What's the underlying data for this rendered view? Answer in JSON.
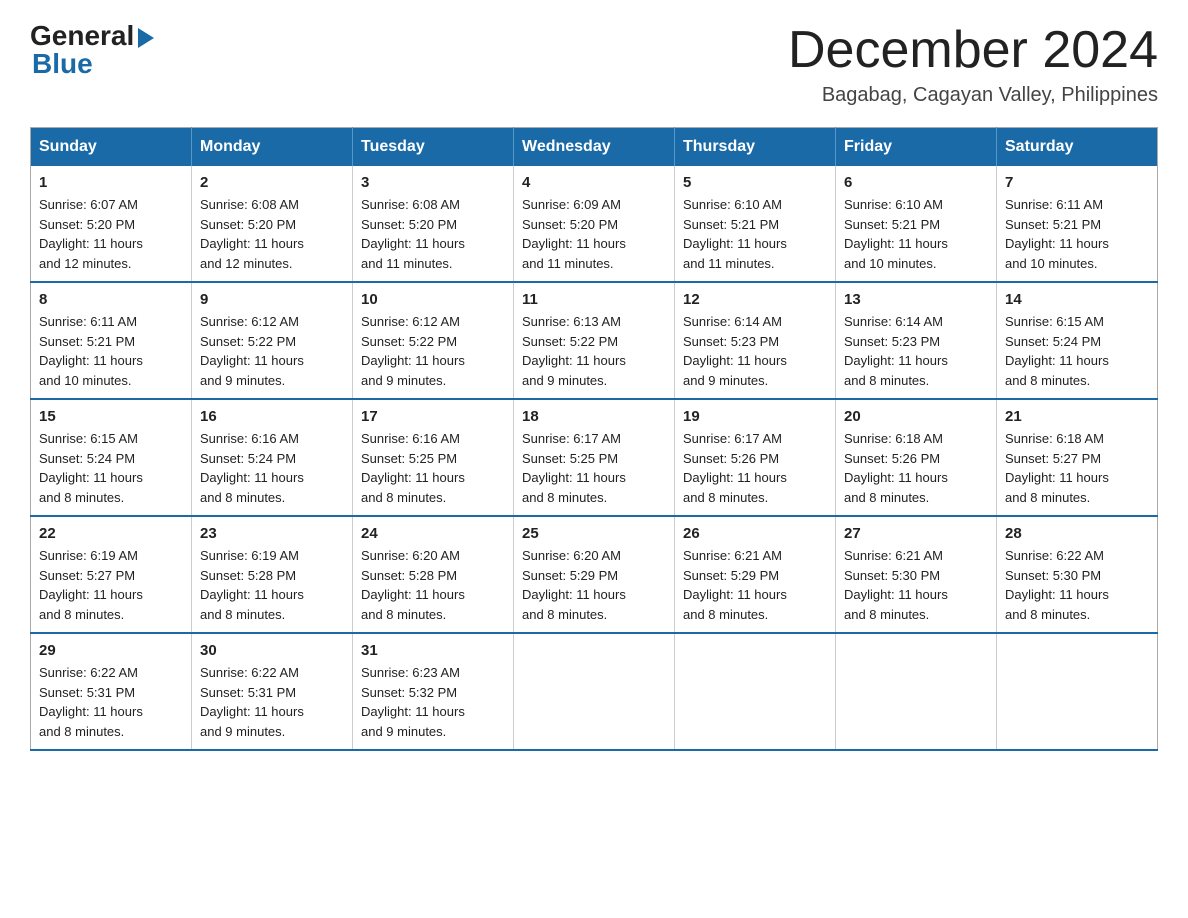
{
  "header": {
    "logo_general": "General",
    "logo_blue": "Blue",
    "month_year": "December 2024",
    "location": "Bagabag, Cagayan Valley, Philippines"
  },
  "calendar": {
    "days_of_week": [
      "Sunday",
      "Monday",
      "Tuesday",
      "Wednesday",
      "Thursday",
      "Friday",
      "Saturday"
    ],
    "weeks": [
      [
        {
          "day": "1",
          "sunrise": "6:07 AM",
          "sunset": "5:20 PM",
          "daylight": "11 hours and 12 minutes."
        },
        {
          "day": "2",
          "sunrise": "6:08 AM",
          "sunset": "5:20 PM",
          "daylight": "11 hours and 12 minutes."
        },
        {
          "day": "3",
          "sunrise": "6:08 AM",
          "sunset": "5:20 PM",
          "daylight": "11 hours and 11 minutes."
        },
        {
          "day": "4",
          "sunrise": "6:09 AM",
          "sunset": "5:20 PM",
          "daylight": "11 hours and 11 minutes."
        },
        {
          "day": "5",
          "sunrise": "6:10 AM",
          "sunset": "5:21 PM",
          "daylight": "11 hours and 11 minutes."
        },
        {
          "day": "6",
          "sunrise": "6:10 AM",
          "sunset": "5:21 PM",
          "daylight": "11 hours and 10 minutes."
        },
        {
          "day": "7",
          "sunrise": "6:11 AM",
          "sunset": "5:21 PM",
          "daylight": "11 hours and 10 minutes."
        }
      ],
      [
        {
          "day": "8",
          "sunrise": "6:11 AM",
          "sunset": "5:21 PM",
          "daylight": "11 hours and 10 minutes."
        },
        {
          "day": "9",
          "sunrise": "6:12 AM",
          "sunset": "5:22 PM",
          "daylight": "11 hours and 9 minutes."
        },
        {
          "day": "10",
          "sunrise": "6:12 AM",
          "sunset": "5:22 PM",
          "daylight": "11 hours and 9 minutes."
        },
        {
          "day": "11",
          "sunrise": "6:13 AM",
          "sunset": "5:22 PM",
          "daylight": "11 hours and 9 minutes."
        },
        {
          "day": "12",
          "sunrise": "6:14 AM",
          "sunset": "5:23 PM",
          "daylight": "11 hours and 9 minutes."
        },
        {
          "day": "13",
          "sunrise": "6:14 AM",
          "sunset": "5:23 PM",
          "daylight": "11 hours and 8 minutes."
        },
        {
          "day": "14",
          "sunrise": "6:15 AM",
          "sunset": "5:24 PM",
          "daylight": "11 hours and 8 minutes."
        }
      ],
      [
        {
          "day": "15",
          "sunrise": "6:15 AM",
          "sunset": "5:24 PM",
          "daylight": "11 hours and 8 minutes."
        },
        {
          "day": "16",
          "sunrise": "6:16 AM",
          "sunset": "5:24 PM",
          "daylight": "11 hours and 8 minutes."
        },
        {
          "day": "17",
          "sunrise": "6:16 AM",
          "sunset": "5:25 PM",
          "daylight": "11 hours and 8 minutes."
        },
        {
          "day": "18",
          "sunrise": "6:17 AM",
          "sunset": "5:25 PM",
          "daylight": "11 hours and 8 minutes."
        },
        {
          "day": "19",
          "sunrise": "6:17 AM",
          "sunset": "5:26 PM",
          "daylight": "11 hours and 8 minutes."
        },
        {
          "day": "20",
          "sunrise": "6:18 AM",
          "sunset": "5:26 PM",
          "daylight": "11 hours and 8 minutes."
        },
        {
          "day": "21",
          "sunrise": "6:18 AM",
          "sunset": "5:27 PM",
          "daylight": "11 hours and 8 minutes."
        }
      ],
      [
        {
          "day": "22",
          "sunrise": "6:19 AM",
          "sunset": "5:27 PM",
          "daylight": "11 hours and 8 minutes."
        },
        {
          "day": "23",
          "sunrise": "6:19 AM",
          "sunset": "5:28 PM",
          "daylight": "11 hours and 8 minutes."
        },
        {
          "day": "24",
          "sunrise": "6:20 AM",
          "sunset": "5:28 PM",
          "daylight": "11 hours and 8 minutes."
        },
        {
          "day": "25",
          "sunrise": "6:20 AM",
          "sunset": "5:29 PM",
          "daylight": "11 hours and 8 minutes."
        },
        {
          "day": "26",
          "sunrise": "6:21 AM",
          "sunset": "5:29 PM",
          "daylight": "11 hours and 8 minutes."
        },
        {
          "day": "27",
          "sunrise": "6:21 AM",
          "sunset": "5:30 PM",
          "daylight": "11 hours and 8 minutes."
        },
        {
          "day": "28",
          "sunrise": "6:22 AM",
          "sunset": "5:30 PM",
          "daylight": "11 hours and 8 minutes."
        }
      ],
      [
        {
          "day": "29",
          "sunrise": "6:22 AM",
          "sunset": "5:31 PM",
          "daylight": "11 hours and 8 minutes."
        },
        {
          "day": "30",
          "sunrise": "6:22 AM",
          "sunset": "5:31 PM",
          "daylight": "11 hours and 9 minutes."
        },
        {
          "day": "31",
          "sunrise": "6:23 AM",
          "sunset": "5:32 PM",
          "daylight": "11 hours and 9 minutes."
        },
        null,
        null,
        null,
        null
      ]
    ],
    "labels": {
      "sunrise": "Sunrise:",
      "sunset": "Sunset:",
      "daylight": "Daylight:"
    }
  }
}
